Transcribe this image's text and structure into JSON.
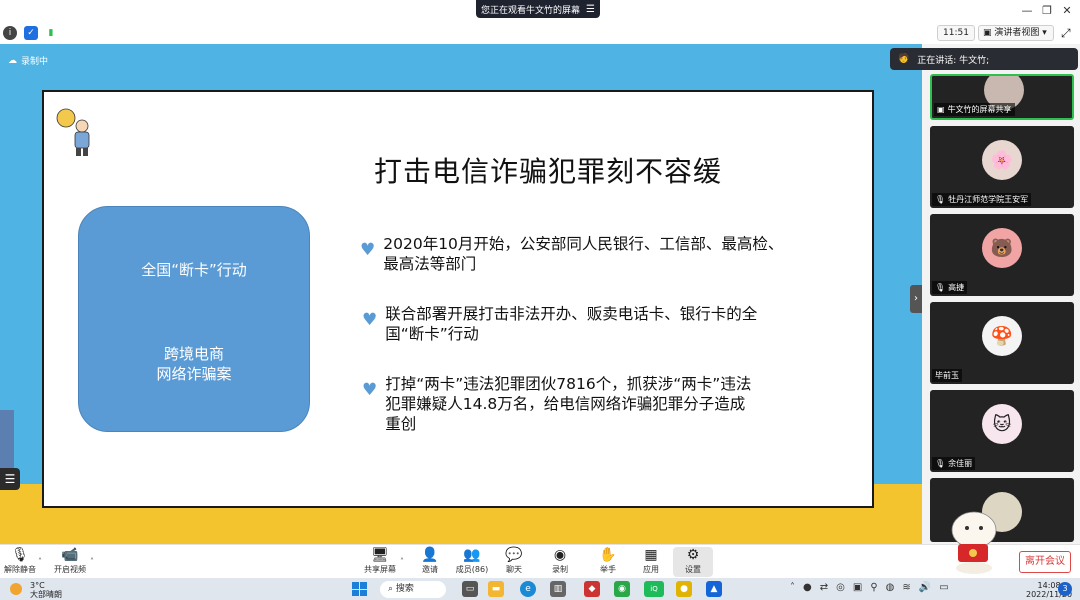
{
  "window": {
    "title": "您正在观看牛文竹的屏幕",
    "menu_icon": "hamburger-icon",
    "controls": [
      "minimize",
      "restore",
      "close"
    ]
  },
  "infobar": {
    "time": "11:51",
    "view_mode": "演讲者视图"
  },
  "stage": {
    "recording_label": "录制中"
  },
  "slide": {
    "title": "打击电信诈骗犯罪刻不容缓",
    "box_line1": "全国“断卡”行动",
    "box_line2": "跨境电商",
    "box_line3": "网络诈骗案",
    "bullets": [
      {
        "line1": "2020年10月开始，公安部同人民银行、工信部、最高检、",
        "line2": "最高法等部门",
        "line3": ""
      },
      {
        "line1": "联合部署开展打击非法开办、贩卖电话卡、银行卡的全",
        "line2": "国“断卡”行动",
        "line3": ""
      },
      {
        "line1": "打掉“两卡”违法犯罪团伙7816个，抓获涉“两卡”违法",
        "line2": "犯罪嫌疑人14.8万名，给电信网络诈骗犯罪分子造成",
        "line3": "重创"
      }
    ]
  },
  "panel": {
    "speaking": "正在讲话: 牛文竹;",
    "participants": [
      {
        "name": "牛文竹的屏幕共享"
      },
      {
        "name": "牡丹江师范学院王安军"
      },
      {
        "name": "高捷"
      },
      {
        "name": "毕前玉"
      },
      {
        "name": "余佳丽"
      }
    ]
  },
  "toolbar": {
    "unmute": "解除静音",
    "start_video": "开启视频",
    "share_screen": "共享屏幕",
    "invite": "邀请",
    "members": "成员(86)",
    "chat": "聊天",
    "record": "录制",
    "raise_hand": "举手",
    "apps": "应用",
    "settings": "设置",
    "leave": "离开会议"
  },
  "taskbar": {
    "temperature": "3°C",
    "weather": "大部晴朗",
    "search": "搜索",
    "time": "14:08",
    "date": "2022/11/20",
    "notification_count": "3"
  },
  "colors": {
    "stage_sky": "#4fb4e4",
    "stage_sand": "#f4c42e",
    "box_blue": "#5b9bd5",
    "active_green": "#2fbf4f",
    "leave_red": "#d63b3b"
  }
}
